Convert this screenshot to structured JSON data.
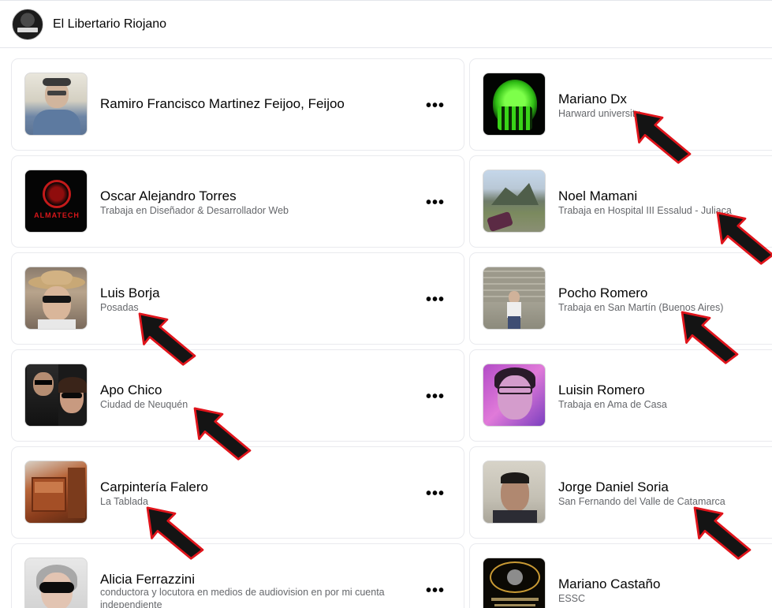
{
  "header": {
    "title": "El Libertario Riojano"
  },
  "more_glyph": "•••",
  "people": [
    {
      "name": "Ramiro Francisco Martinez Feijoo, Feijoo",
      "subtitle": ""
    },
    {
      "name": "Mariano Dx",
      "subtitle": "Harward university"
    },
    {
      "name": "Oscar Alejandro Torres",
      "subtitle": "Trabaja en Diseñador & Desarrollador Web"
    },
    {
      "name": "Noel Mamani",
      "subtitle": "Trabaja en Hospital III Essalud - Juliaca"
    },
    {
      "name": "Luis Borja",
      "subtitle": "Posadas"
    },
    {
      "name": "Pocho Romero",
      "subtitle": "Trabaja en San Martín (Buenos Aires)"
    },
    {
      "name": "Apo Chico",
      "subtitle": "Ciudad de Neuquén"
    },
    {
      "name": "Luisin Romero",
      "subtitle": "Trabaja en Ama de Casa"
    },
    {
      "name": "Carpintería Falero",
      "subtitle": "La Tablada"
    },
    {
      "name": "Jorge Daniel Soria",
      "subtitle": "San Fernando del Valle de Catamarca"
    },
    {
      "name": "Alicia Ferrazzini",
      "subtitle": "conductora y locutora en medios de audiovision en por mi cuenta independiente"
    },
    {
      "name": "Mariano Castaño",
      "subtitle": "ESSC"
    }
  ],
  "thumb_labels": {
    "almatech": "ALMATECH"
  },
  "colors": {
    "arrow_fill": "#141414",
    "arrow_outline": "#e0141b",
    "secondary_text": "#65676b"
  }
}
